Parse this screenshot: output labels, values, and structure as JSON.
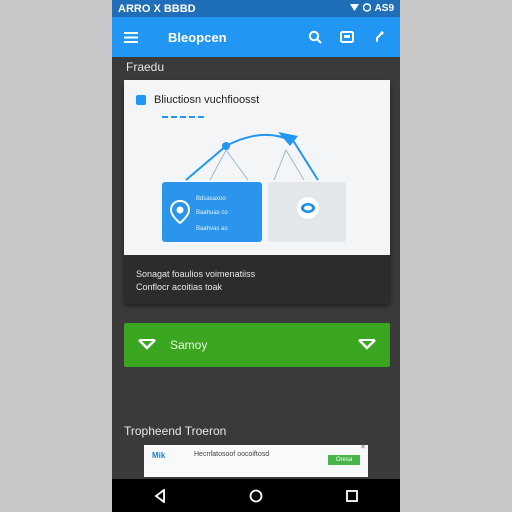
{
  "status_bar": {
    "left_text": "ARRO X BBBD",
    "right_text": "AS9"
  },
  "app_bar": {
    "title": "Bleopcen"
  },
  "section_title": "Fraedu",
  "card": {
    "header_text": "Bliuctiosn vuchfioosst",
    "blue_panel_lines": [
      "Bdsasaxoo",
      "Baahuas co",
      "Baahvas ao"
    ],
    "caption_line1": "Sonagat foaulios voimenatiiss",
    "caption_line2": "Conflocr acoitias toak"
  },
  "primary_button": {
    "label": "Samoy"
  },
  "section_title_2": "Tropheend Troeron",
  "ad": {
    "brand": "Mik",
    "text": "Hecnfatosoof oocoiftosd",
    "cta": "Oresa"
  },
  "colors": {
    "app_bar": "#2196f3",
    "status_bar": "#1f6fb8",
    "primary_button": "#3aa61f",
    "background": "#3a3a3a"
  }
}
